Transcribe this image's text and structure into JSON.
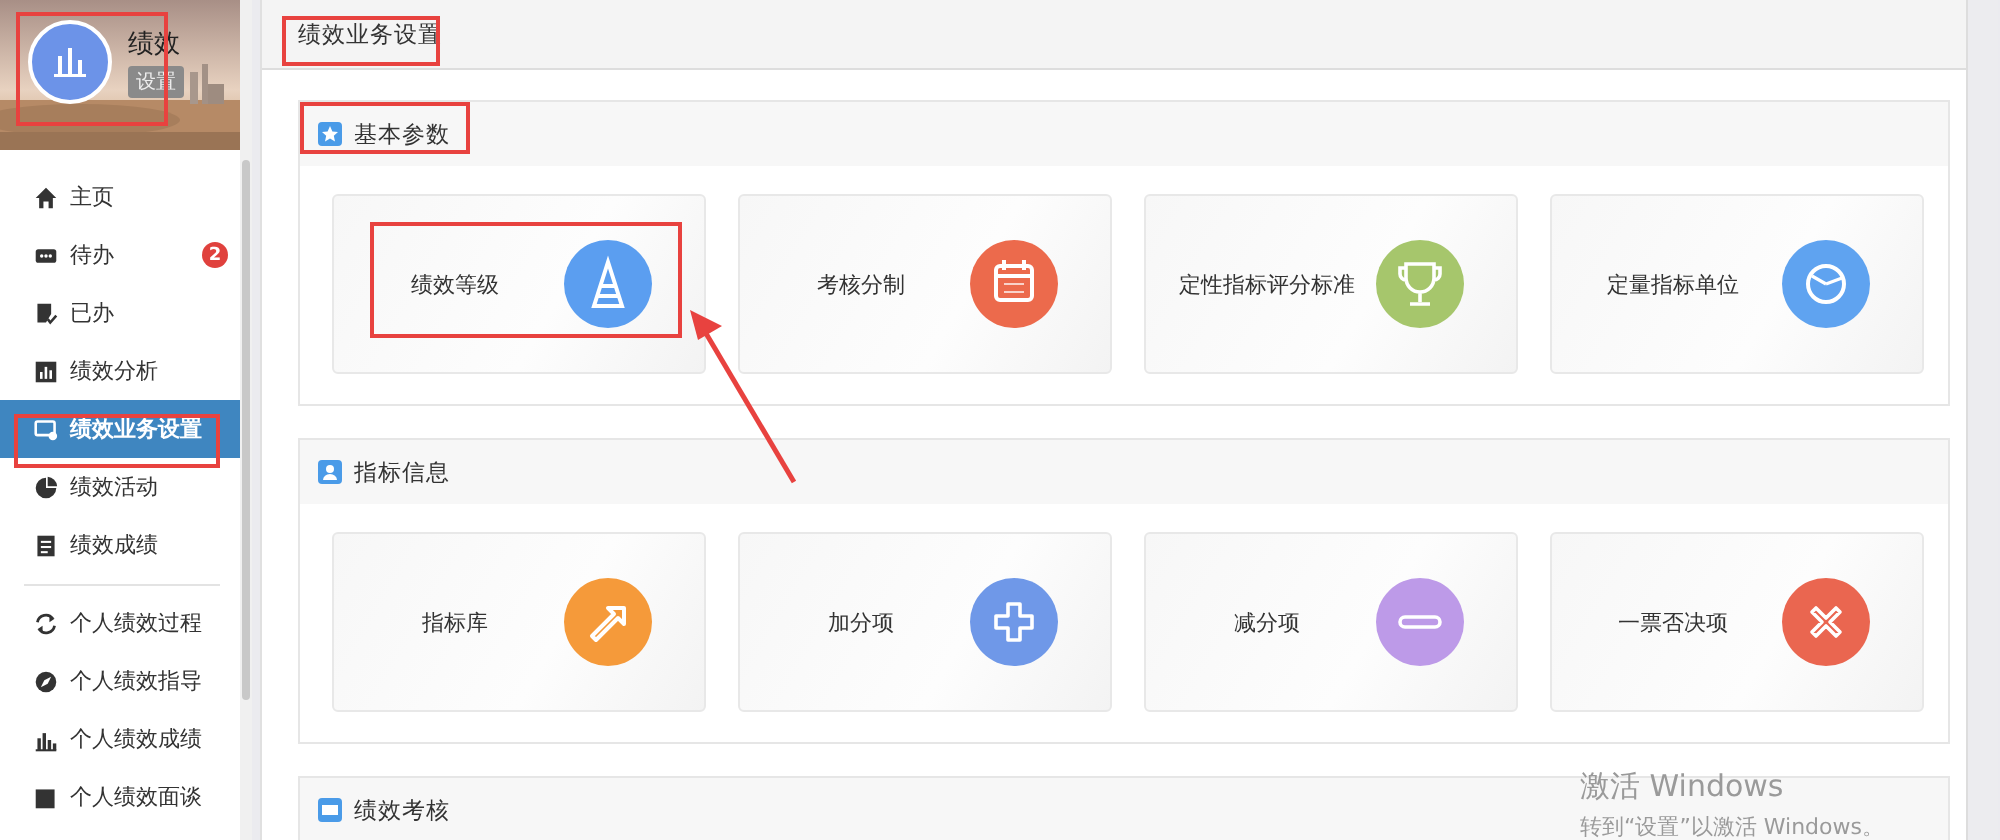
{
  "app": {
    "name": "绩效",
    "badge": "设置"
  },
  "nav_groups": [
    [
      {
        "label": "主页",
        "selected": false
      },
      {
        "label": "待办",
        "selected": false,
        "count": "2"
      },
      {
        "label": "已办",
        "selected": false
      },
      {
        "label": "绩效分析",
        "selected": false
      },
      {
        "label": "绩效业务设置",
        "selected": true
      },
      {
        "label": "绩效活动",
        "selected": false
      },
      {
        "label": "绩效成绩",
        "selected": false
      }
    ],
    [
      {
        "label": "个人绩效过程",
        "selected": false
      },
      {
        "label": "个人绩效指导",
        "selected": false
      },
      {
        "label": "个人绩效成绩",
        "selected": false
      },
      {
        "label": "个人绩效面谈",
        "selected": false
      }
    ]
  ],
  "page_tab": "绩效业务设置",
  "sections": [
    {
      "title": "基本参数",
      "cards": [
        {
          "label": "绩效等级",
          "color": "#5b9ef0"
        },
        {
          "label": "考核分制",
          "color": "#ec6a4c"
        },
        {
          "label": "定性指标评分标准",
          "color": "#a6c66c"
        },
        {
          "label": "定量指标单位",
          "color": "#5fa3f0"
        }
      ]
    },
    {
      "title": "指标信息",
      "cards": [
        {
          "label": "指标库",
          "color": "#f59a3a"
        },
        {
          "label": "加分项",
          "color": "#6f98e8"
        },
        {
          "label": "减分项",
          "color": "#bd9ae8"
        },
        {
          "label": "一票否决项",
          "color": "#ea6650"
        }
      ]
    },
    {
      "title": "绩效考核"
    }
  ],
  "os_notice": {
    "title": "激活 Windows",
    "text": "转到“设置”以激活 Windows。"
  }
}
